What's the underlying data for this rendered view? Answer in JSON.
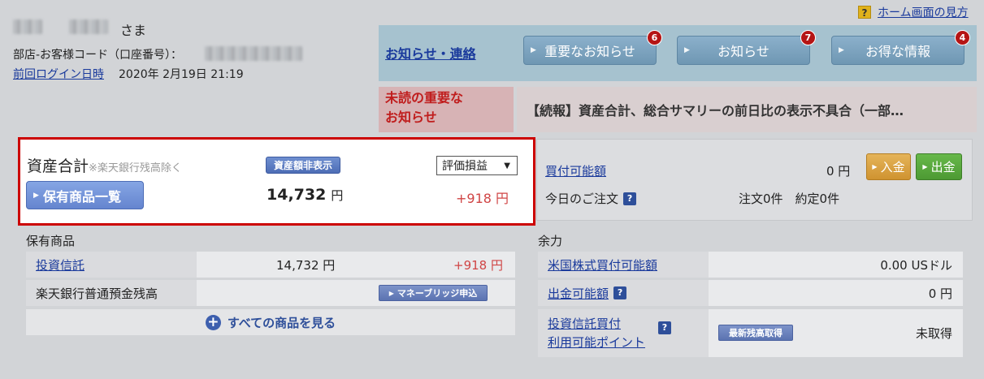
{
  "header": {
    "salutation": "さま",
    "branch_label": "部店-お客様コード（口座番号）：",
    "last_login_link": "前回ログイン日時",
    "last_login_value": "2020年 2月19日 21:19",
    "help_icon": "question-icon",
    "help_link": "ホーム画面の見方"
  },
  "notices": {
    "title": "お知らせ・連絡",
    "buttons": [
      {
        "label": "重要なお知らせ",
        "count": "6"
      },
      {
        "label": "お知らせ",
        "count": "7"
      },
      {
        "label": "お得な情報",
        "count": "4"
      }
    ],
    "unread_label_line1": "未読の重要な",
    "unread_label_line2": "お知らせ",
    "unread_text": "【続報】資産合計、総合サマリーの前日比の表示不具合（一部…"
  },
  "asset": {
    "title": "資産合計",
    "note": "※楽天銀行残高除く",
    "hide_button": "資産額非表示",
    "select_value": "評価損益",
    "holdings_button": "保有商品一覧",
    "total": "14,732",
    "total_unit": "円",
    "gain": "+918 円"
  },
  "buying": {
    "label": "買付可能額",
    "value": "0 円",
    "deposit_button": "入金",
    "withdraw_button": "出金",
    "orders_label": "今日のご注文",
    "orders_value": "注文0件　約定0件"
  },
  "holdings": {
    "title": "保有商品",
    "rows": [
      {
        "label": "投資信託",
        "value": "14,732 円",
        "gain": "+918 円"
      },
      {
        "label": "楽天銀行普通預金残高",
        "button": "マネーブリッジ申込"
      }
    ],
    "see_all": "すべての商品を見る"
  },
  "capacity": {
    "title": "余力",
    "rows": [
      {
        "label": "米国株式買付可能額",
        "value": "0.00 USドル"
      },
      {
        "label": "出金可能額",
        "value": "0 円"
      },
      {
        "label_line1": "投資信託買付",
        "label_line2": "利用可能ポイント",
        "button": "最新残高取得",
        "value": "未取得"
      }
    ]
  },
  "colors": {
    "accent_red": "#cc0000",
    "gain_red": "#d04545",
    "link_blue": "#1a3a9c",
    "notice_bg": "#a6c2cf"
  }
}
